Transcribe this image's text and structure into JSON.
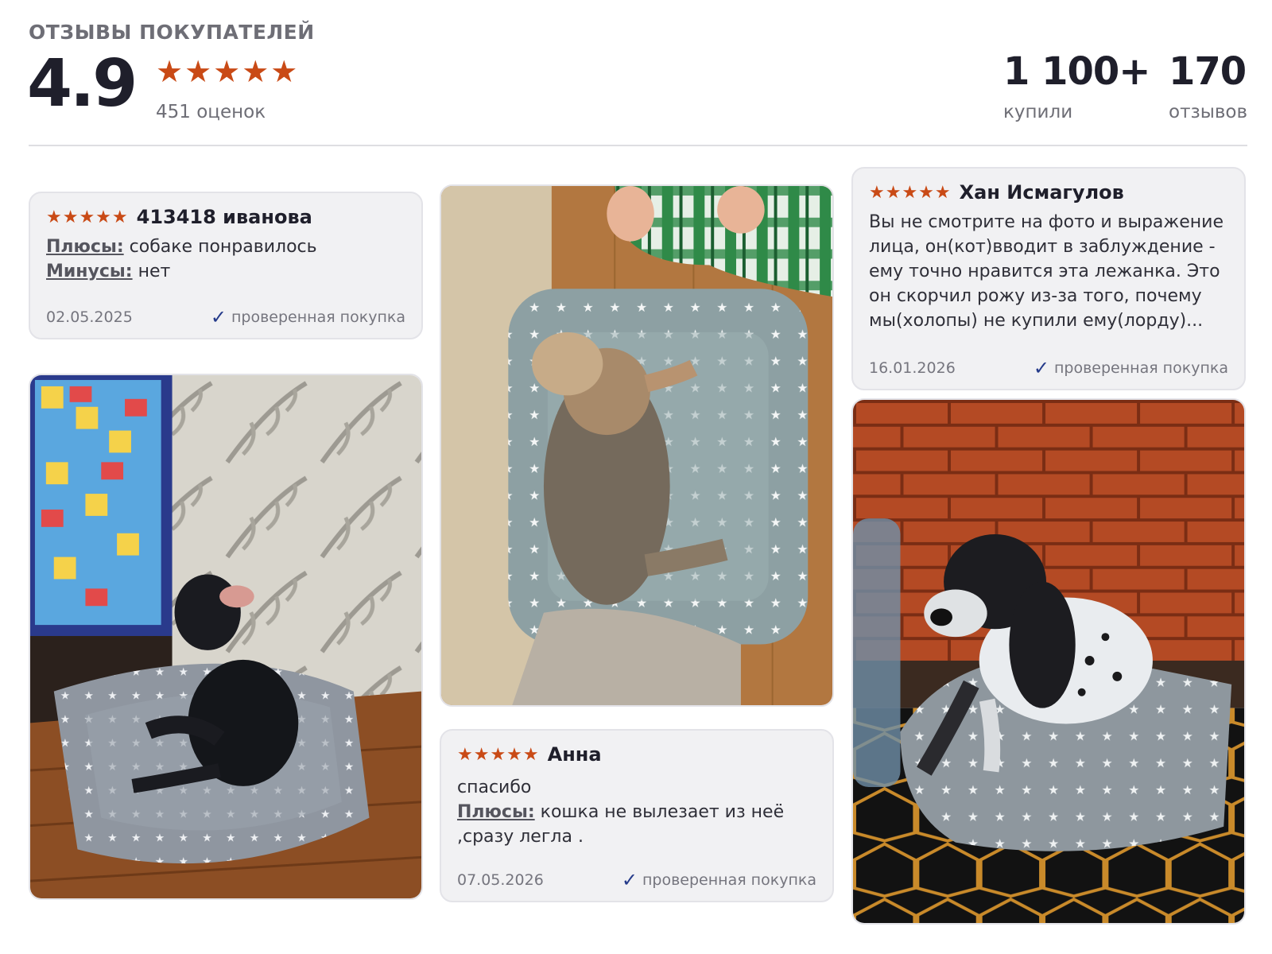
{
  "header": {
    "title": "ОТЗЫВЫ ПОКУПАТЕЛЕЙ",
    "rating": "4.9",
    "stars": "★★★★★",
    "ratings_count": "451 оценок",
    "bought_value": "1 100+",
    "bought_label": "купили",
    "reviews_value": "170",
    "reviews_label": "отзывов"
  },
  "colors": {
    "star": "#c94a16",
    "check": "#243a8a",
    "card_bg": "#f1f1f3"
  },
  "reviews": [
    {
      "stars": "★★★★★",
      "author": "413418 иванова",
      "pros_label": "Плюсы:",
      "pros": "собаке понравилось",
      "cons_label": "Минусы:",
      "cons": "нет",
      "date": "02.05.2025",
      "verified": "проверенная покупка"
    },
    {
      "stars": "★★★★★",
      "author": "Хан Исмагулов",
      "text": "Вы не смотрите на фото и выражение лица, он(кот)вводит в заблуждение - ему точно нравится эта лежанка. Это он скорчил рожу из-за того, почему мы(холопы) не купили ему(лорду)...",
      "date": "16.01.2026",
      "verified": "проверенная покупка"
    },
    {
      "stars": "★★★★★",
      "author": "Анна",
      "text": "спасибо",
      "pros_label": "Плюсы:",
      "pros": "кошка не вылезает из неё ,сразу легла .",
      "date": "07.05.2026",
      "verified": "проверенная покупка"
    }
  ],
  "check_icon": "check-icon",
  "star_icon": "star-icon"
}
